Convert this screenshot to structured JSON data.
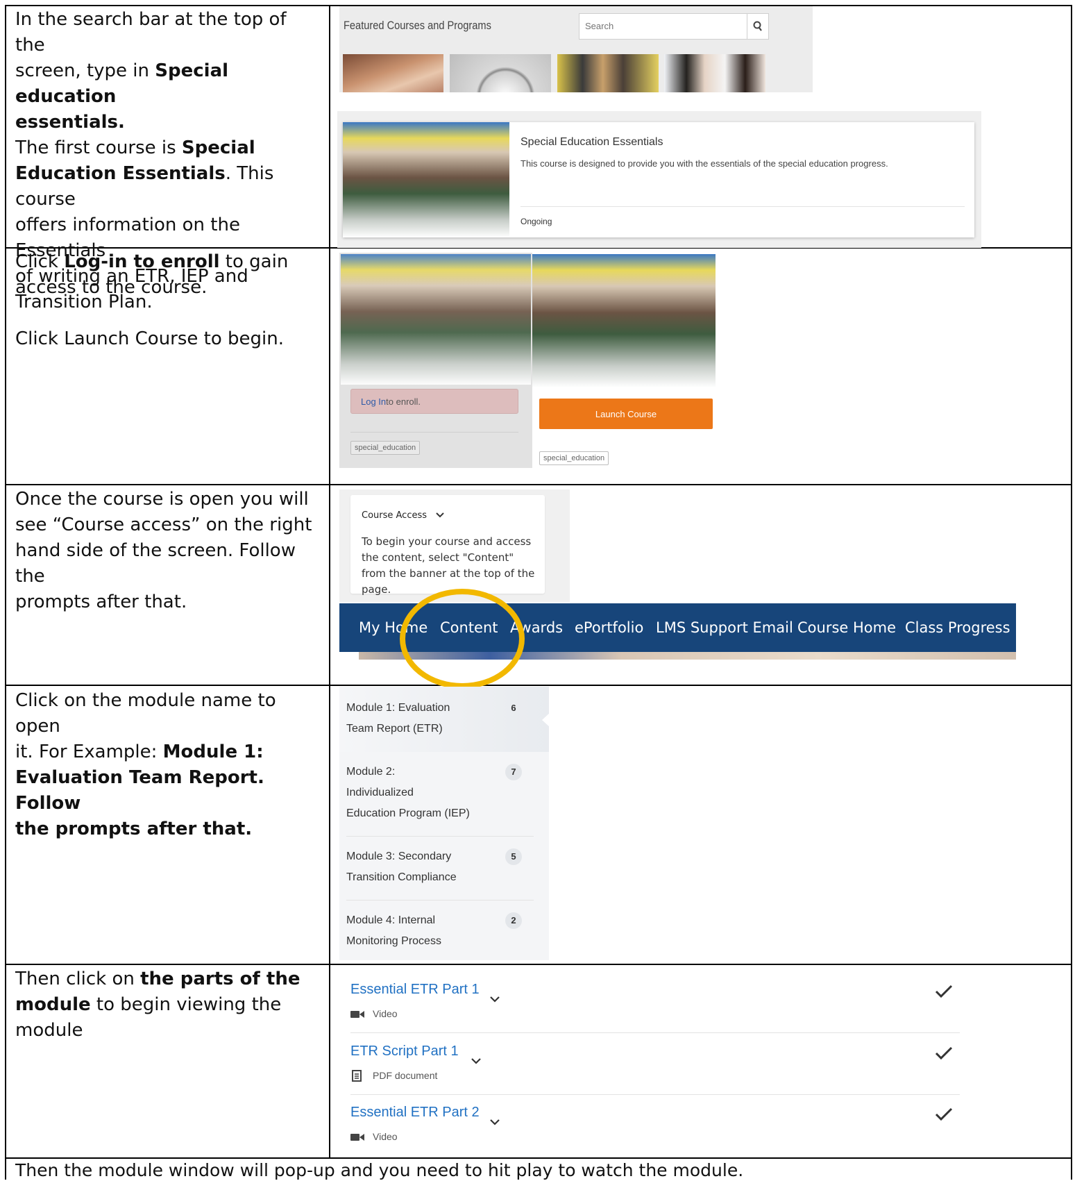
{
  "rows": {
    "r1": {
      "l1": "In the search bar at the top of the",
      "l2a": "screen, type in ",
      "l2b": "Special education",
      "l3": "essentials.",
      "l4a": "The first course is ",
      "l4b": "Special",
      "l5a": "Education Essentials",
      "l5b": ". This course",
      "l6": "offers information on the Essentials",
      "l7": "of writing an ETR, IEP and",
      "l8": "Transition Plan."
    },
    "r2": {
      "l1a": "Click ",
      "l1b": "Log-in to enroll",
      "l1c": " to gain",
      "l2": "access to the course.",
      "l3": "Click Launch Course to begin."
    },
    "r3": {
      "l1": "Once the course is open you will",
      "l2": "see “Course access” on the right",
      "l3": "hand side of the screen. Follow the",
      "l4": "prompts after that."
    },
    "r4": {
      "l1": "Click on the module name to open",
      "l2a": "it. For Example: ",
      "l2b": "Module 1:",
      "l3": "Evaluation Team Report. Follow",
      "l4": "the prompts after that."
    },
    "r5": {
      "l1a": "Then click on ",
      "l1b": "the parts of the",
      "l2a": "module",
      "l2b": " to begin viewing the",
      "l3": "module"
    },
    "footer": "Then the module window will pop-up and you need to hit play to watch the module."
  },
  "catalog": {
    "title": "Featured Courses and Programs",
    "search_placeholder": "Search"
  },
  "course_card": {
    "title": "Special Education Essentials",
    "description": "This course is designed to provide you with the essentials of the special education progress.",
    "status": "Ongoing"
  },
  "enroll": {
    "login_link": "Log In",
    "login_rest": " to enroll.",
    "tag": "special_education",
    "launch": "Launch Course"
  },
  "course_access": {
    "title": "Course Access",
    "text": "To begin your course and access the content, select \"Content\" from the banner at the top of the page."
  },
  "nav": [
    "My Home",
    "Content",
    "Awards",
    "ePortfolio",
    "LMS Support Email",
    "Course Home",
    "Class Progress"
  ],
  "modules": [
    {
      "lines": [
        "Module 1: Evaluation",
        "Team Report (ETR)"
      ],
      "count": "6"
    },
    {
      "lines": [
        "Module 2:",
        "Individualized",
        "Education Program (IEP)"
      ],
      "count": "7"
    },
    {
      "lines": [
        "Module 3: Secondary",
        "Transition Compliance"
      ],
      "count": "5"
    },
    {
      "lines": [
        "Module 4: Internal",
        "Monitoring Process"
      ],
      "count": "2"
    }
  ],
  "parts": [
    {
      "title": "Essential ETR Part 1",
      "type": "Video",
      "icon": "video-camera-icon"
    },
    {
      "title": "ETR Script Part 1",
      "type": "PDF document",
      "icon": "document-icon"
    },
    {
      "title": "Essential ETR Part 2",
      "type": "Video",
      "icon": "video-camera-icon"
    }
  ],
  "colors": {
    "nav": "#17457a",
    "launch": "#ec7718",
    "highlight": "#f2b800",
    "part_link": "#2171c3"
  }
}
